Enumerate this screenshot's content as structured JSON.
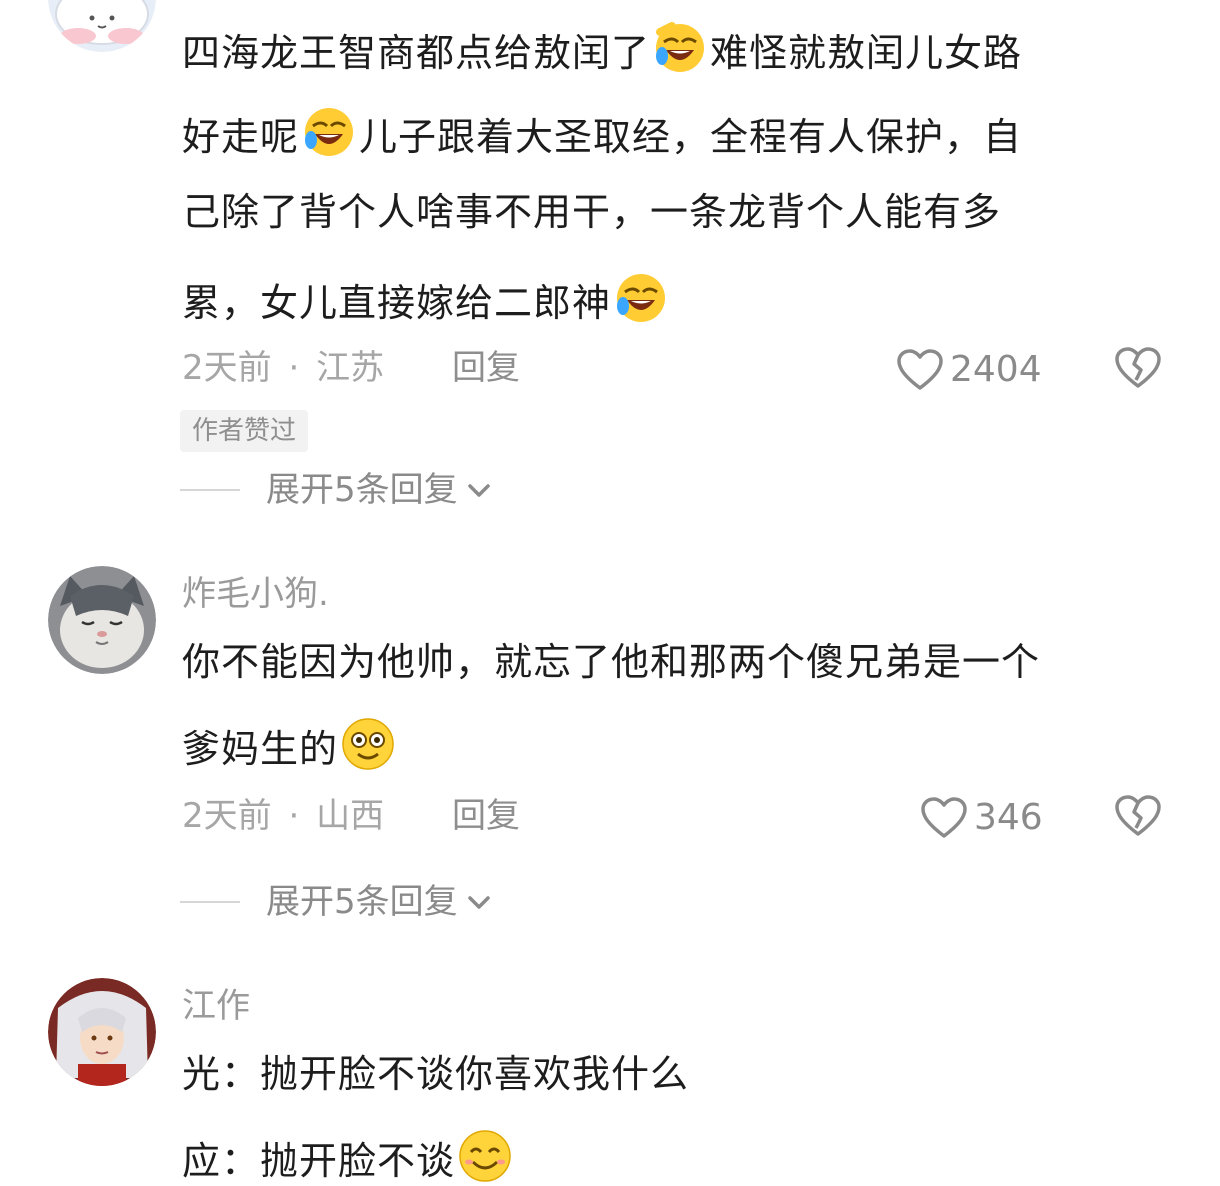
{
  "comments": [
    {
      "lines": [
        {
          "text": "四海龙王智商都点给敖闰了",
          "emoji_after": "rofl-emoji",
          "text2": "难怪就敖闰儿女路"
        },
        {
          "text": "好走呢",
          "emoji_after": "rofl-emoji",
          "text2": "儿子跟着大圣取经，全程有人保护，自"
        },
        {
          "text": "己除了背个人啥事不用干，一条龙背个人能有多"
        },
        {
          "text": "累，女儿直接嫁给二郎神",
          "emoji_after": "rofl-emoji"
        }
      ],
      "time": "2天前",
      "location": "江苏",
      "reply_label": "回复",
      "likes": "2404",
      "badge": "作者赞过",
      "expand_label": "展开5条回复"
    },
    {
      "username": "炸毛小狗.",
      "lines": [
        {
          "text": "你不能因为他帅，就忘了他和那两个傻兄弟是一个"
        },
        {
          "text": "爹妈生的",
          "emoji_after": "dazed-emoji"
        }
      ],
      "time": "2天前",
      "location": "山西",
      "reply_label": "回复",
      "likes": "346",
      "expand_label": "展开5条回复"
    },
    {
      "username": "江作",
      "lines": [
        {
          "text": "光：抛开脸不谈你喜欢我什么"
        },
        {
          "text": "应：抛开脸不谈",
          "emoji_after": "smile-emoji"
        }
      ]
    }
  ],
  "meta_separator": "·",
  "colors": {
    "text": "#1d1d1d",
    "muted": "#a6a6a6",
    "badge_bg": "#f2f2f2"
  },
  "icons": [
    "heart-outline-icon",
    "broken-heart-icon",
    "chevron-down-icon"
  ]
}
